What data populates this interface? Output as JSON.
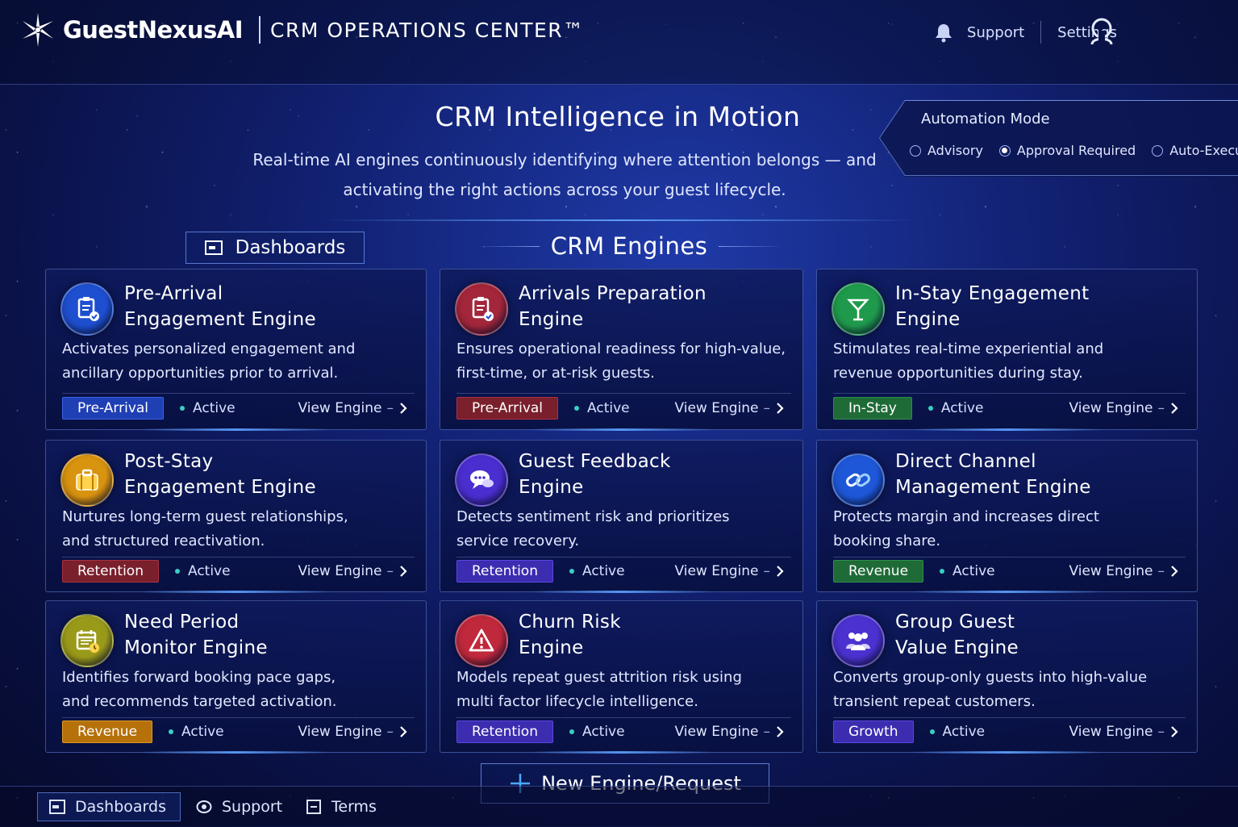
{
  "brand": {
    "name": "GuestNexusAI",
    "app_title": "CRM OPERATIONS CENTER™"
  },
  "top_nav": {
    "support": "Support",
    "settings": "Settings"
  },
  "hero": {
    "title": "CRM Intelligence in Motion",
    "subtitle_line1": "Real-time AI engines continuously identifying where attention belongs — and",
    "subtitle_line2": "activating the right actions across your guest lifecycle."
  },
  "automation_mode": {
    "title": "Automation Mode",
    "options": [
      {
        "label": "Advisory",
        "selected": false
      },
      {
        "label": "Approval Required",
        "selected": true
      },
      {
        "label": "Auto-Execute",
        "selected": false
      }
    ]
  },
  "dashboards_button": "Dashboards",
  "engines_heading": "CRM Engines",
  "engines": [
    {
      "title_line1": "Pre-Arrival",
      "title_line2": "Engagement Engine",
      "desc_line1": "Activates personalized engagement and",
      "desc_line2": "ancillary opportunities prior to arrival.",
      "tag": "Pre-Arrival",
      "status": "Active",
      "link": "View Engine",
      "icon": "clipboard-check-icon",
      "color": "#1e4fd0"
    },
    {
      "title_line1": "Arrivals Preparation",
      "title_line2": "Engine",
      "desc_line1": "Ensures operational readiness for high-value,",
      "desc_line2": "first-time, or at-risk guests.",
      "tag": "Pre-Arrival",
      "status": "Active",
      "link": "View Engine",
      "icon": "clipboard-check-icon",
      "color": "#a3263a"
    },
    {
      "title_line1": "In-Stay Engagement",
      "title_line2": "Engine",
      "desc_line1": "Stimulates real-time experiential and",
      "desc_line2": "revenue opportunities during stay.",
      "tag": "In-Stay",
      "status": "Active",
      "link": "View Engine",
      "icon": "cocktail-icon",
      "color": "#1f9a4c"
    },
    {
      "title_line1": "Post-Stay",
      "title_line2": "Engagement Engine",
      "desc_line1": "Nurtures long-term guest relationships,",
      "desc_line2": "and structured reactivation.",
      "tag": "Retention",
      "status": "Active",
      "link": "View Engine",
      "icon": "suitcase-icon",
      "color": "#d8930f"
    },
    {
      "title_line1": "Guest Feedback",
      "title_line2": "Engine",
      "desc_line1": "Detects sentiment risk and prioritizes",
      "desc_line2": "service recovery.",
      "tag": "Retention",
      "status": "Active",
      "link": "View Engine",
      "icon": "chat-bubbles-icon",
      "color": "#4a2ed0"
    },
    {
      "title_line1": "Direct Channel",
      "title_line2": "Management Engine",
      "desc_line1": "Protects margin and increases direct",
      "desc_line2": "booking share.",
      "tag": "Revenue",
      "status": "Active",
      "link": "View Engine",
      "icon": "link-icon",
      "color": "#1e58d8"
    },
    {
      "title_line1": "Need Period",
      "title_line2": "Monitor Engine",
      "desc_line1": "Identifies forward booking pace gaps,",
      "desc_line2": "and recommends targeted activation.",
      "tag": "Revenue",
      "status": "Active",
      "link": "View Engine",
      "icon": "calendar-icon",
      "color": "#9a9a1a"
    },
    {
      "title_line1": "Churn Risk",
      "title_line2": "Engine",
      "desc_line1": "Models repeat guest attrition risk using",
      "desc_line2": "multi factor lifecycle intelligence.",
      "tag": "Retention",
      "status": "Active",
      "link": "View Engine",
      "icon": "warning-icon",
      "color": "#c0283c"
    },
    {
      "title_line1": "Group Guest",
      "title_line2": "Value Engine",
      "desc_line1": "Converts group-only guests into high-value",
      "desc_line2": "transient repeat customers.",
      "tag": "Growth",
      "status": "Active",
      "link": "View Engine",
      "icon": "group-icon",
      "color": "#4b32d0"
    }
  ],
  "new_engine_button": "New Engine/Request",
  "footer": {
    "dashboards": "Dashboards",
    "support": "Support",
    "terms": "Terms"
  }
}
